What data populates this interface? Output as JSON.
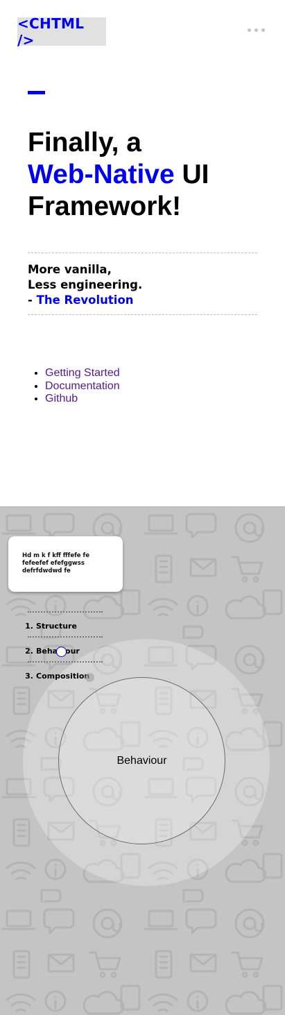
{
  "header": {
    "logo_text": "<CHTML />",
    "menu_icon": "more-horizontal-icon"
  },
  "hero": {
    "line1": "Finally, a",
    "line2_accent": "Web-Native",
    "line2_rest": " UI",
    "line3": "Framework!"
  },
  "tagline": {
    "line1": "More vanilla,",
    "line2": "Less engineering.",
    "line3_prefix": "- ",
    "line3_accent": "The Revolution"
  },
  "links": [
    {
      "label": "Getting Started"
    },
    {
      "label": "Documentation"
    },
    {
      "label": "Github"
    }
  ],
  "showcase": {
    "card_text": "Hd m k f kff fffefe fe fefeefef efefggwss defrfdwdwd fe",
    "steps": [
      {
        "num": "1.",
        "label": "Structure"
      },
      {
        "num": "2.",
        "label": "Behaviour"
      },
      {
        "num": "3.",
        "label": "Composition"
      }
    ],
    "active_step": "Behaviour",
    "circle_label": "Behaviour"
  },
  "colors": {
    "accent": "#0000ee",
    "link": "#551a8b",
    "showcase_bg": "#c4c4c4"
  }
}
